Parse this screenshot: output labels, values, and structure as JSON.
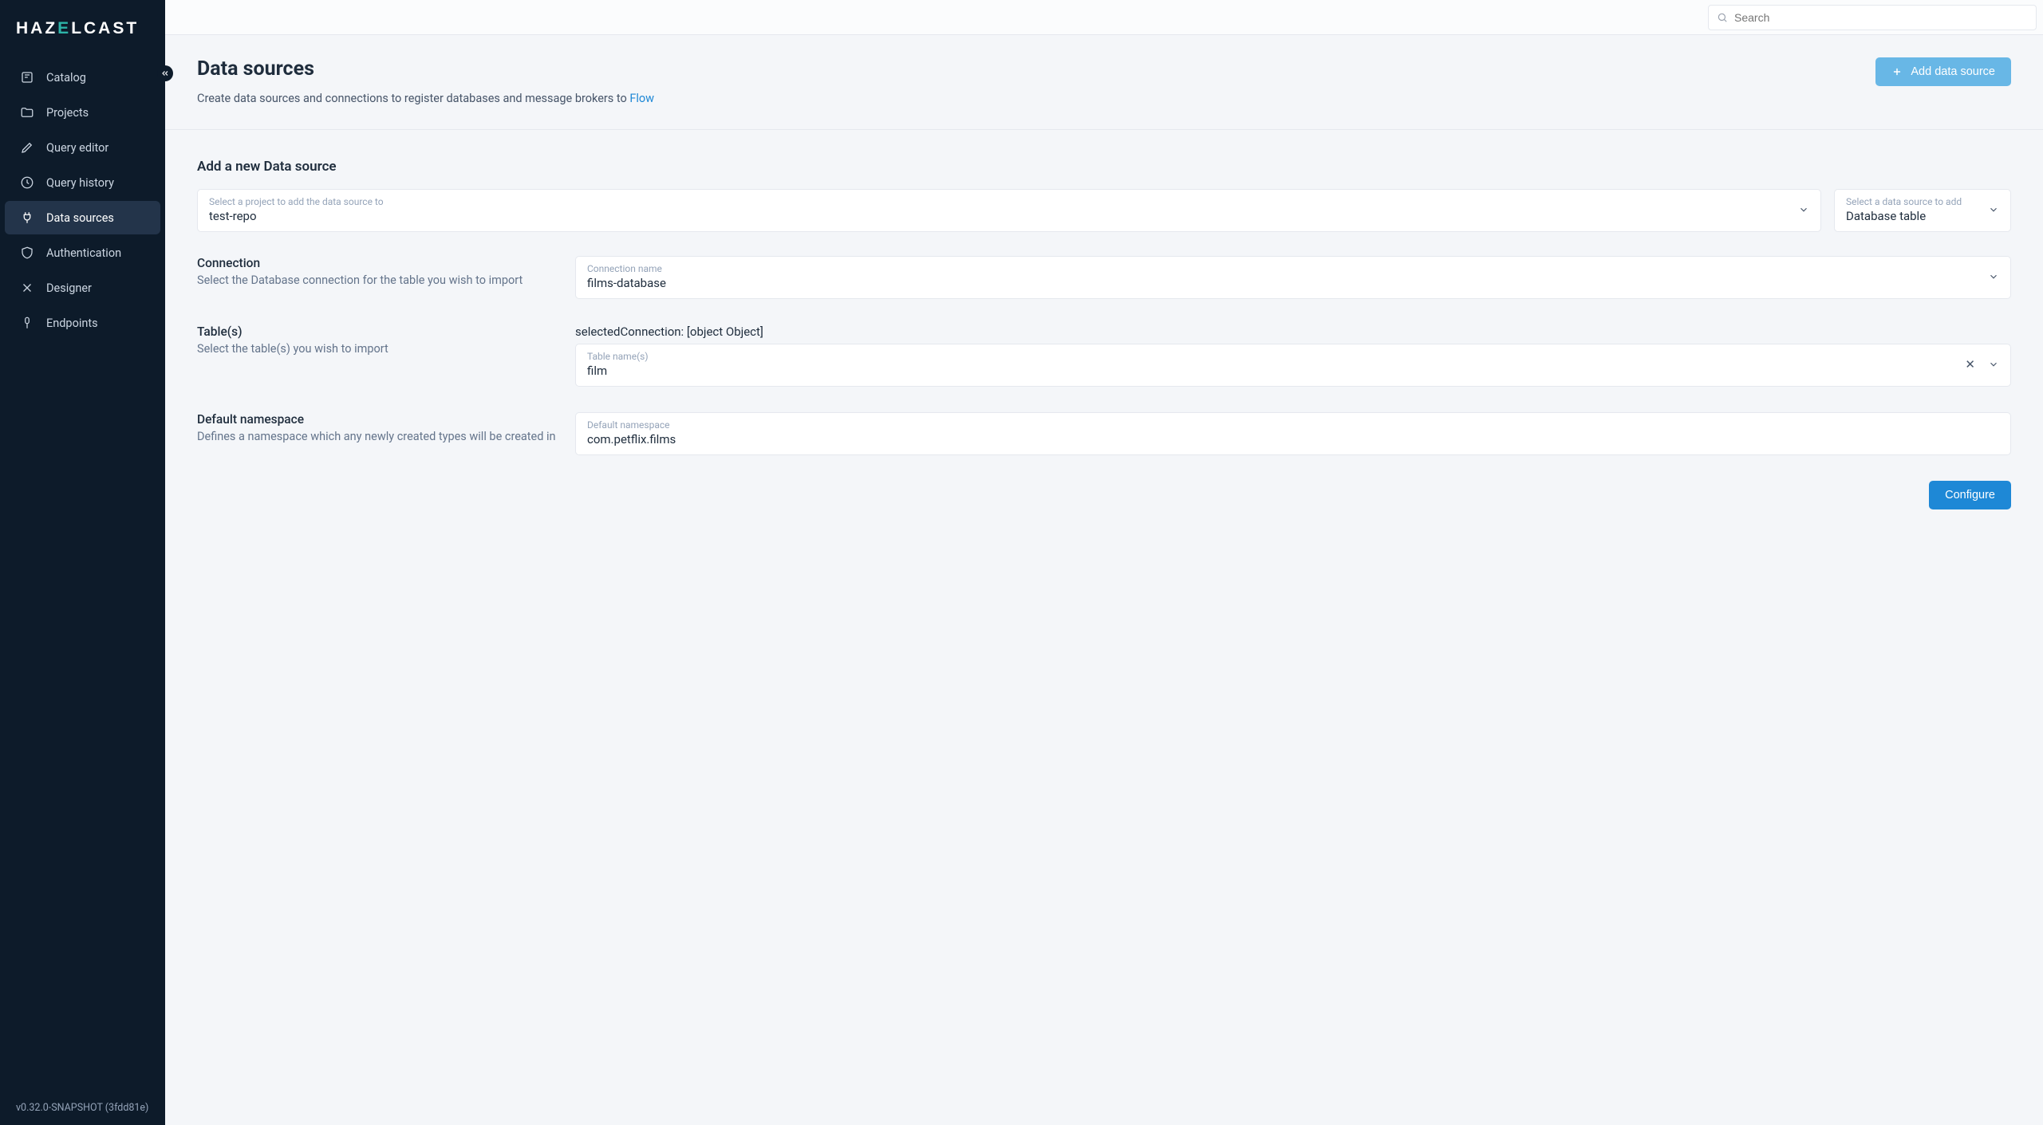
{
  "brand": {
    "pre": "HAZ",
    "z": "E",
    "post": "LCAST"
  },
  "search": {
    "placeholder": "Search"
  },
  "sidebar": {
    "items": [
      {
        "label": "Catalog"
      },
      {
        "label": "Projects"
      },
      {
        "label": "Query editor"
      },
      {
        "label": "Query history"
      },
      {
        "label": "Data sources"
      },
      {
        "label": "Authentication"
      },
      {
        "label": "Designer"
      },
      {
        "label": "Endpoints"
      }
    ],
    "version": "v0.32.0-SNAPSHOT (3fdd81e)"
  },
  "header": {
    "title": "Data sources",
    "subtitle_pre": "Create data sources and connections to register databases and message brokers to ",
    "subtitle_link": "Flow",
    "add_label": "Add data source"
  },
  "form": {
    "section_title": "Add a new Data source",
    "project": {
      "label": "Select a project to add the data source to",
      "value": "test-repo"
    },
    "type": {
      "label": "Select a data source to add",
      "value": "Database table"
    },
    "connection": {
      "title": "Connection",
      "desc": "Select the Database connection for the table you wish to import",
      "field_label": "Connection name",
      "value": "films-database"
    },
    "tables": {
      "title": "Table(s)",
      "desc": "Select the table(s) you wish to import",
      "debug": "selectedConnection: [object Object]",
      "field_label": "Table name(s)",
      "value": "film"
    },
    "namespace": {
      "title": "Default namespace",
      "desc": "Defines a namespace which any newly created types will be created in",
      "field_label": "Default namespace",
      "value": "com.petflix.films"
    },
    "configure_label": "Configure"
  }
}
